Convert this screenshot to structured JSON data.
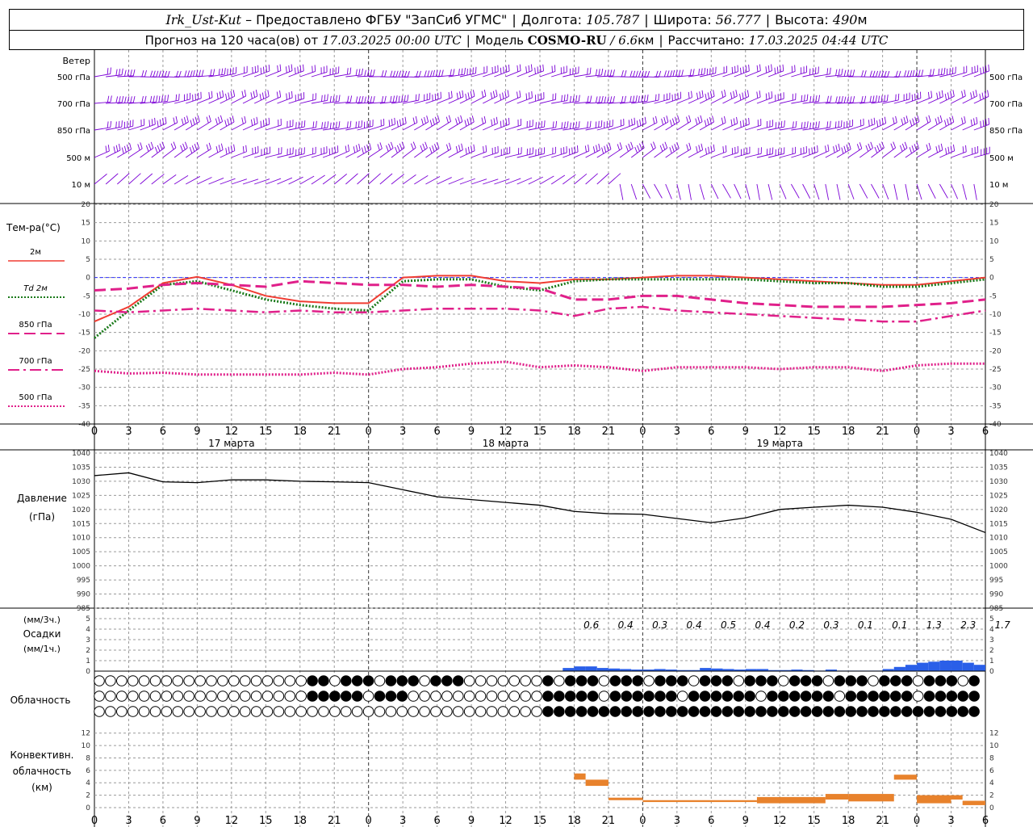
{
  "header": {
    "station": "Irk_Ust-Kut",
    "provider": "– Предоставлено ФГБУ \"ЗапСиб УГМС\"",
    "lon_label": "Долгота:",
    "lon_value": "105.787",
    "lat_label": "Широта:",
    "lat_value": "56.777",
    "alt_label": "Высота:",
    "alt_value": "490",
    "alt_unit": "м",
    "forecast_label": "Прогноз на 120 часа(ов) от",
    "forecast_start": "17.03.2025 00:00 UTC",
    "model_label": "Модель",
    "model_name": "COSMO-RU",
    "model_res": "/ 6.6",
    "model_res_unit": "км",
    "calc_label": "Рассчитано:",
    "calc_time": "17.03.2025 04:44 UTC"
  },
  "chart_data": [
    {
      "type": "line",
      "panel": "wind",
      "title": "Ветер",
      "levels": [
        "500 гПа",
        "700 гПа",
        "850 гПа",
        "500 м",
        "10 м"
      ],
      "colors": {
        "barbs": "#7b00d6"
      }
    },
    {
      "type": "line",
      "panel": "temperature",
      "ylabel": "Тем-ра(°C)",
      "ylim": [
        -40,
        20
      ],
      "yticks": [
        20,
        15,
        10,
        5,
        0,
        -5,
        -10,
        -15,
        -20,
        -25,
        -30,
        -35,
        -40
      ],
      "x_hours": [
        0,
        3,
        6,
        9,
        12,
        15,
        18,
        21,
        24,
        27,
        30,
        33,
        36,
        39,
        42,
        45,
        48,
        51,
        54,
        57,
        60,
        63,
        66,
        69,
        72,
        75,
        78
      ],
      "series": [
        {
          "name": "2м",
          "color": "#f03c32",
          "style": "solid",
          "values": [
            -12,
            -8,
            -1.5,
            0.2,
            -2,
            -5,
            -6.5,
            -7,
            -7,
            0,
            0.5,
            0.5,
            -1,
            -1.5,
            -0.5,
            -0.5,
            0,
            0.5,
            0.5,
            0,
            -0.5,
            -1,
            -1.5,
            -2,
            -2,
            -1,
            0
          ]
        },
        {
          "name": "Td 2м",
          "color": "#1a7a1a",
          "style": "dotted",
          "values": [
            -16.5,
            -9,
            -2,
            -1,
            -3.5,
            -6,
            -7.5,
            -8.5,
            -9,
            -1,
            -0.5,
            -0.5,
            -2.5,
            -3.5,
            -1,
            -0.5,
            -0.5,
            -0.5,
            -0.5,
            -0.5,
            -1,
            -1.5,
            -1.5,
            -2.5,
            -2.5,
            -1.5,
            -0.5
          ]
        },
        {
          "name": "850 гПа",
          "color": "#e0208a",
          "style": "dashed",
          "values": [
            -3.5,
            -3,
            -2,
            -1.5,
            -2,
            -2.5,
            -1,
            -1.5,
            -2,
            -2,
            -2.5,
            -2,
            -2.5,
            -3,
            -6,
            -6,
            -5,
            -5,
            -6,
            -7,
            -7.5,
            -8,
            -8,
            -8,
            -7.5,
            -7,
            -6
          ]
        },
        {
          "name": "700 гПа",
          "color": "#e0208a",
          "style": "dashdot",
          "values": [
            -9,
            -9.5,
            -9,
            -8.5,
            -9,
            -9.5,
            -9,
            -9.5,
            -9.5,
            -9,
            -8.5,
            -8.5,
            -8.5,
            -9,
            -10.5,
            -8.5,
            -8,
            -9,
            -9.5,
            -10,
            -10.5,
            -11,
            -11.5,
            -12,
            -12,
            -10.5,
            -9
          ]
        },
        {
          "name": "500 гПа",
          "color": "#e0208a",
          "style": "dotted",
          "values": [
            -25.5,
            -26.2,
            -26,
            -26.5,
            -26.5,
            -26.5,
            -26.5,
            -26,
            -26.5,
            -25,
            -24.5,
            -23.5,
            -23,
            -24.5,
            -24,
            -24.5,
            -25.5,
            -24.5,
            -24.5,
            -24.5,
            -25,
            -24.5,
            -24.5,
            -25.5,
            -24,
            -23.5,
            -23.5
          ]
        }
      ],
      "zero_line_color": "#3030ff"
    },
    {
      "type": "line",
      "panel": "pressure",
      "ylabel": "Давление",
      "yunit": "(гПа)",
      "ylim": [
        985,
        1040
      ],
      "yticks": [
        1040,
        1035,
        1030,
        1025,
        1020,
        1015,
        1010,
        1005,
        1000,
        995,
        990,
        985
      ],
      "x_hours": [
        0,
        3,
        6,
        9,
        12,
        15,
        18,
        21,
        24,
        27,
        30,
        33,
        36,
        39,
        42,
        45,
        48,
        51,
        54,
        57,
        60,
        63,
        66,
        69,
        72,
        75,
        78
      ],
      "series": [
        {
          "name": "p",
          "color": "#000000",
          "values": [
            1032,
            1033,
            1029.8,
            1029.5,
            1030.5,
            1030.5,
            1030,
            1029.8,
            1029.5,
            1027,
            1024.5,
            1023.5,
            1022.5,
            1021.5,
            1019.3,
            1018.5,
            1018.3,
            1016.8,
            1015.3,
            1017,
            1020,
            1020.8,
            1021.5,
            1020.8,
            1019,
            1016.5,
            1011.8
          ]
        }
      ]
    },
    {
      "type": "bar",
      "panel": "precipitation",
      "ylabel": "Осадки",
      "yunit_top": "(мм/3ч.)",
      "yunit_bottom": "(мм/1ч.)",
      "ylim": [
        0,
        5
      ],
      "yticks": [
        5,
        4,
        3,
        2,
        1,
        0
      ],
      "totals_3h": [
        "0.6",
        "0.4",
        "0.3",
        "0.4",
        "0.5",
        "0.4",
        "0.2",
        "0.3",
        "0.1",
        "0.1",
        "1.3",
        "2.3",
        "1.7"
      ],
      "color": "#2a5fe8"
    },
    {
      "type": "table",
      "panel": "cloud_cover",
      "ylabel": "Облачность",
      "rows": 3
    },
    {
      "type": "bar",
      "panel": "convective_clouds",
      "ylabel_lines": [
        "Конвективн.",
        "облачность",
        "(км)"
      ],
      "ylim": [
        0,
        13
      ],
      "yticks": [
        12,
        10,
        8,
        6,
        4,
        2,
        0
      ],
      "color": "#e8822c"
    }
  ],
  "xaxis": {
    "hour_labels": [
      "0",
      "3",
      "6",
      "9",
      "12",
      "15",
      "18",
      "21",
      "0",
      "3",
      "6",
      "9",
      "12",
      "15",
      "18",
      "21",
      "0",
      "3",
      "6",
      "9",
      "12",
      "15",
      "18",
      "21",
      "0",
      "3",
      "6"
    ],
    "day_labels": [
      "17 марта",
      "18 марта",
      "19 марта"
    ]
  }
}
